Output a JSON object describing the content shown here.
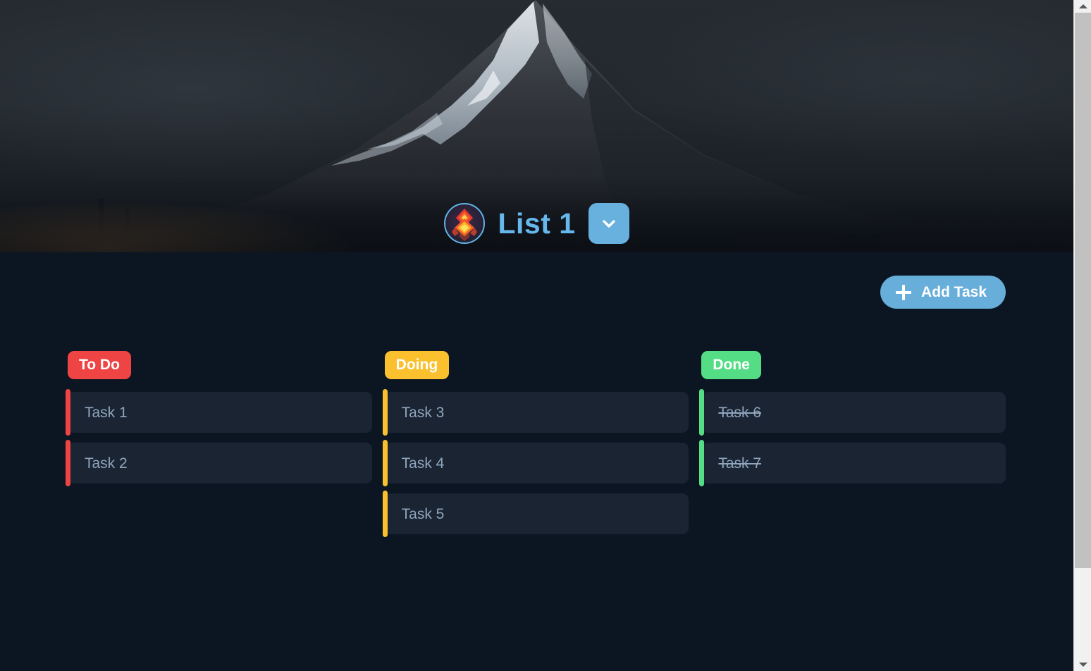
{
  "banner": {
    "image_alt": "dark mountain peak",
    "avatar_icon": "flame-emblem-avatar"
  },
  "header": {
    "title": "List 1",
    "dropdown_icon": "chevron-down-icon",
    "title_color": "#66b8ec",
    "dropdown_bg": "#68b0dd"
  },
  "toolbar": {
    "add_task_label": "Add Task",
    "add_task_icon": "plus-icon",
    "add_task_bg": "#67aedb"
  },
  "board": {
    "columns": [
      {
        "name": "To Do",
        "color": "#ef4444",
        "tasks": [
          {
            "label": "Task 1",
            "done": false
          },
          {
            "label": "Task 2",
            "done": false
          }
        ]
      },
      {
        "name": "Doing",
        "color": "#fbc02d",
        "tasks": [
          {
            "label": "Task 3",
            "done": false
          },
          {
            "label": "Task 4",
            "done": false
          },
          {
            "label": "Task 5",
            "done": false
          }
        ]
      },
      {
        "name": "Done",
        "color": "#55dd86",
        "tasks": [
          {
            "label": "Task 6",
            "done": true
          },
          {
            "label": "Task 7",
            "done": true
          }
        ]
      }
    ]
  },
  "scrollbar": {
    "up_icon": "scroll-up-arrow-icon",
    "down_icon": "scroll-down-arrow-icon",
    "thumb": "scrollbar-thumb"
  },
  "theme": {
    "page_bg": "#0b1622",
    "card_bg": "#1a2433",
    "task_text": "#8fa5bd"
  }
}
